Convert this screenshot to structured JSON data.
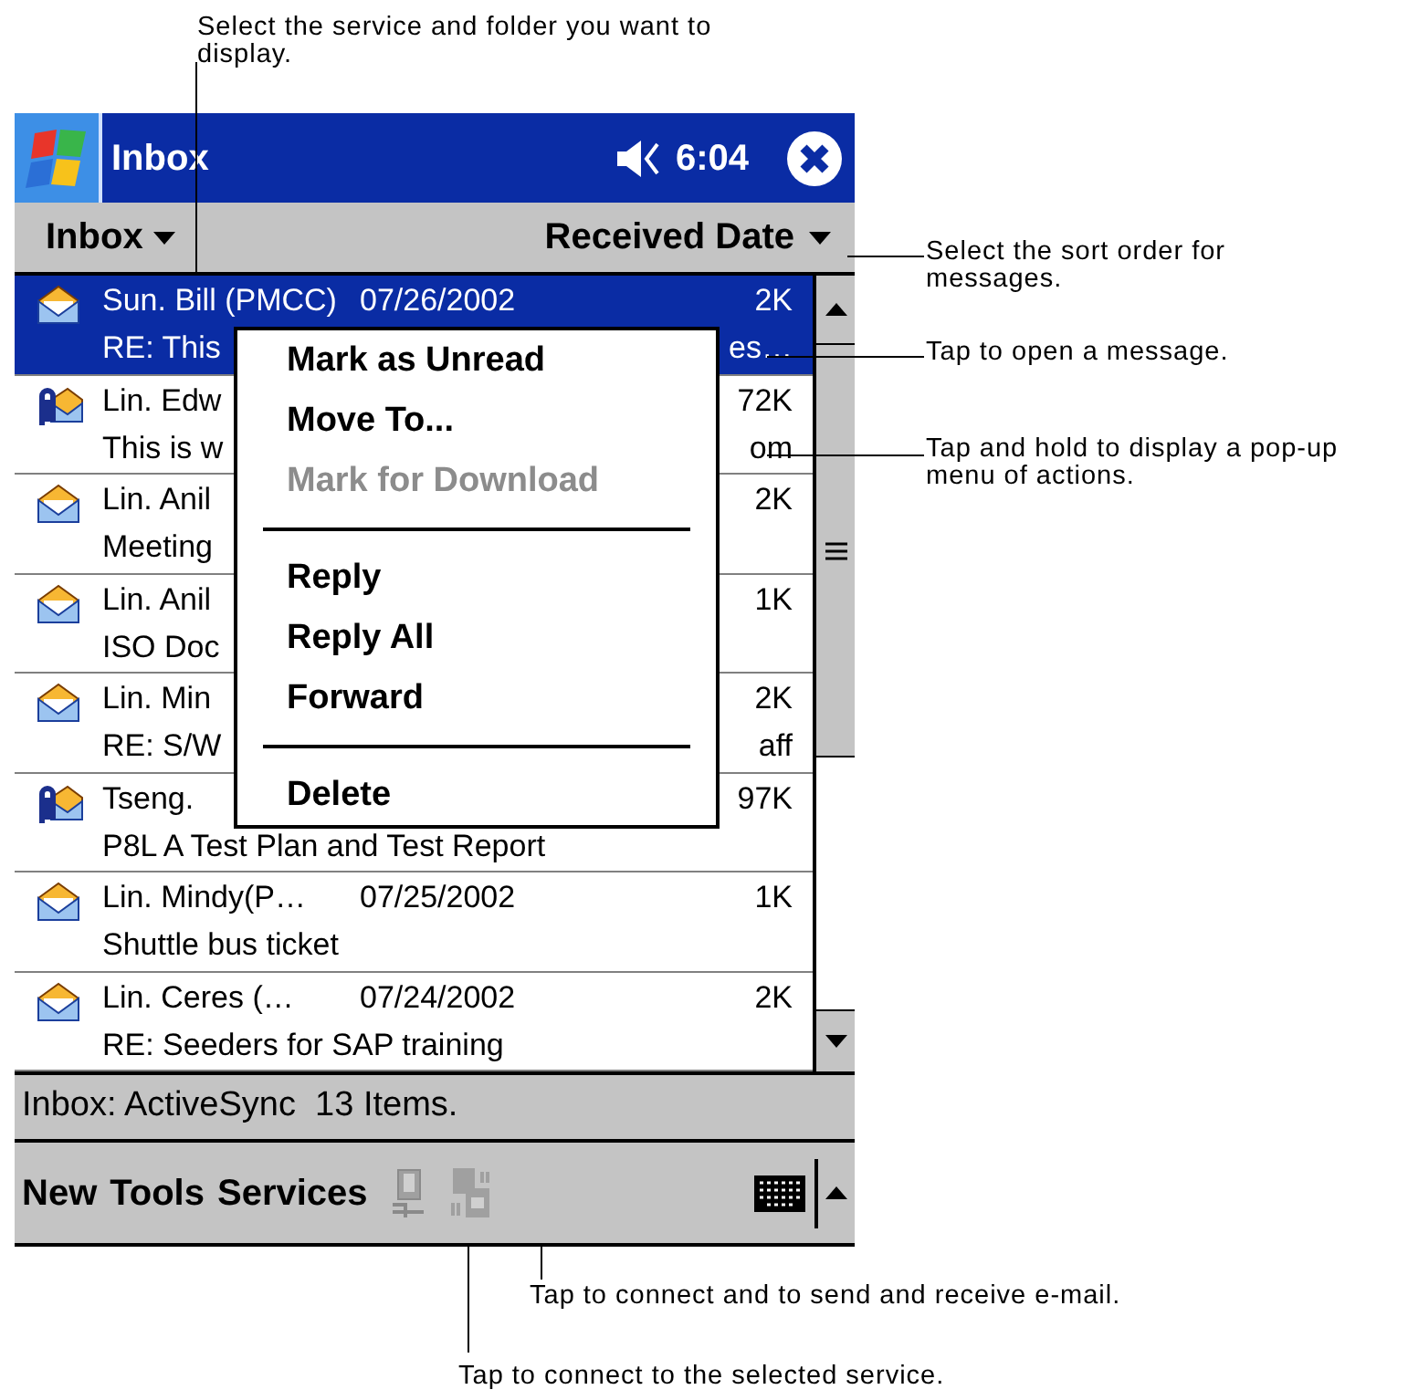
{
  "annotations": [
    {
      "text": "Select the service and folder you want to display."
    },
    {
      "text": "Select the sort order for messages."
    },
    {
      "text": "Tap to open a message."
    },
    {
      "text": "Tap and hold to display a pop-up menu of actions."
    },
    {
      "text": "Tap to connect and to send and receive e-mail."
    },
    {
      "text": "Tap to connect to the selected service."
    }
  ],
  "title_bar": {
    "title": "Inbox",
    "time": "6:04"
  },
  "header": {
    "folder": "Inbox",
    "sort": "Received Date"
  },
  "messages": [
    {
      "kind": "mail",
      "selected": true,
      "sender": "Sun. Bill (PMCC)",
      "date": "07/26/2002",
      "size": "2K",
      "subject": "RE: This",
      "subject_tail": "es…"
    },
    {
      "kind": "attachment",
      "selected": false,
      "sender": "Lin. Edw",
      "size": "72K",
      "subject": "This is w",
      "subject_tail": "om"
    },
    {
      "kind": "mail",
      "selected": false,
      "sender": "Lin. Anil",
      "size": "2K",
      "subject": "Meeting"
    },
    {
      "kind": "mail",
      "selected": false,
      "sender": "Lin. Anil",
      "size": "1K",
      "subject": "ISO Doc"
    },
    {
      "kind": "mail",
      "selected": false,
      "sender": "Lin. Min",
      "size": "2K",
      "subject": "RE: S/W",
      "subject_tail": "aff"
    },
    {
      "kind": "attachment",
      "selected": false,
      "sender": "Tseng.",
      "size": "97K",
      "subject": "P8L A Test Plan and Test Report"
    },
    {
      "kind": "mail",
      "selected": false,
      "sender": "Lin. Mindy(P…",
      "date": "07/25/2002",
      "size": "1K",
      "subject": "Shuttle bus ticket"
    },
    {
      "kind": "mail",
      "selected": false,
      "sender": "Lin. Ceres (…",
      "date": "07/24/2002",
      "size": "2K",
      "subject": "RE: Seeders for SAP training"
    }
  ],
  "context_menu": [
    {
      "kind": "item",
      "label": "Mark as Unread",
      "disabled": false
    },
    {
      "kind": "item",
      "label": "Move To...",
      "disabled": false
    },
    {
      "kind": "item",
      "label": "Mark for Download",
      "disabled": true
    },
    {
      "kind": "separator"
    },
    {
      "kind": "item",
      "label": "Reply",
      "disabled": false
    },
    {
      "kind": "item",
      "label": "Reply All",
      "disabled": false
    },
    {
      "kind": "item",
      "label": "Forward",
      "disabled": false
    },
    {
      "kind": "separator"
    },
    {
      "kind": "item",
      "label": "Delete",
      "disabled": false
    }
  ],
  "status_bar": "Inbox: ActiveSync  13 Items.",
  "command_bar": {
    "menus": [
      "New",
      "Tools",
      "Services"
    ]
  }
}
